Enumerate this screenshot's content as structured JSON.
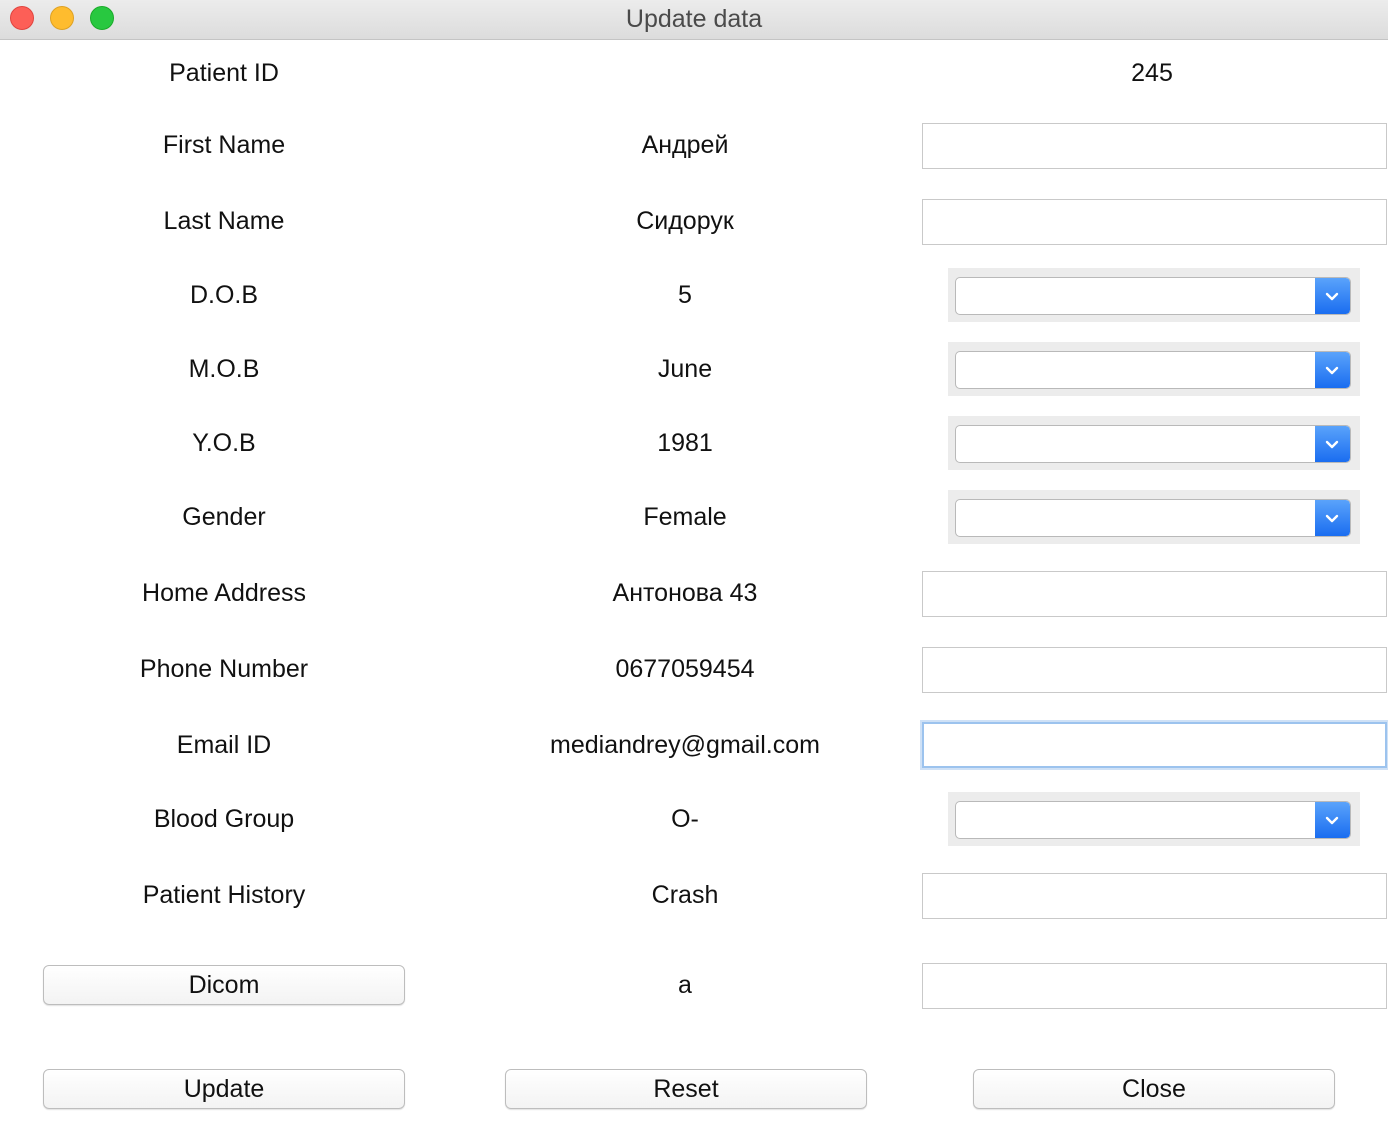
{
  "window": {
    "title": "Update data"
  },
  "rows": {
    "patient_id": {
      "label": "Patient ID",
      "value": "245"
    },
    "first_name": {
      "label": "First Name",
      "value": "Андрей",
      "input": ""
    },
    "last_name": {
      "label": "Last Name",
      "value": "Сидорук",
      "input": ""
    },
    "dob": {
      "label": "D.O.B",
      "value": "5",
      "selected": ""
    },
    "mob": {
      "label": "M.O.B",
      "value": "June",
      "selected": ""
    },
    "yob": {
      "label": "Y.O.B",
      "value": "1981",
      "selected": ""
    },
    "gender": {
      "label": "Gender",
      "value": "Female",
      "selected": ""
    },
    "home_address": {
      "label": "Home Address",
      "value": "Антонова 43",
      "input": ""
    },
    "phone": {
      "label": "Phone Number",
      "value": "0677059454",
      "input": ""
    },
    "email": {
      "label": "Email ID",
      "value": "mediandrey@gmail.com",
      "input": ""
    },
    "blood_group": {
      "label": "Blood Group",
      "value": "O-",
      "selected": ""
    },
    "history": {
      "label": "Patient History",
      "value": "Crash",
      "input": ""
    },
    "dicom": {
      "button_label": "Dicom",
      "value": "a",
      "input": ""
    }
  },
  "actions": {
    "update": "Update",
    "reset": "Reset",
    "close": "Close"
  },
  "colors": {
    "accent": "#1a6df0",
    "focus_ring": "#9cc3ee"
  }
}
